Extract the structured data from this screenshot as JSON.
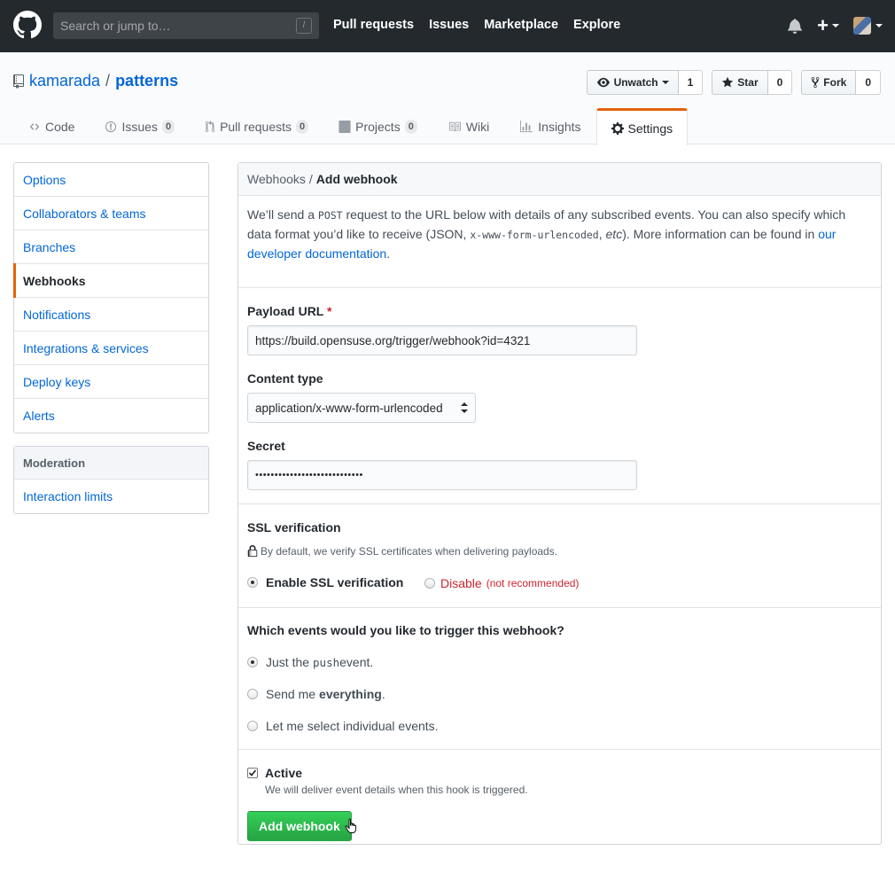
{
  "header": {
    "search_placeholder": "Search or jump to…",
    "search_shortcut": "/",
    "nav": [
      "Pull requests",
      "Issues",
      "Marketplace",
      "Explore"
    ],
    "plus_label": "+"
  },
  "repo": {
    "owner": "kamarada",
    "separator": "/",
    "name": "patterns",
    "watch_label": "Unwatch",
    "watch_count": "1",
    "star_label": "Star",
    "star_count": "0",
    "fork_label": "Fork",
    "fork_count": "0",
    "tabs": {
      "code": "Code",
      "issues": "Issues",
      "issues_count": "0",
      "pulls": "Pull requests",
      "pulls_count": "0",
      "projects": "Projects",
      "projects_count": "0",
      "wiki": "Wiki",
      "insights": "Insights",
      "settings": "Settings"
    }
  },
  "sidebar": {
    "items": [
      "Options",
      "Collaborators & teams",
      "Branches",
      "Webhooks",
      "Notifications",
      "Integrations & services",
      "Deploy keys",
      "Alerts"
    ],
    "selected": "Webhooks",
    "moderation_heading": "Moderation",
    "moderation_items": [
      "Interaction limits"
    ]
  },
  "webhook": {
    "breadcrumb_parent": "Webhooks",
    "breadcrumb_sep": "/",
    "breadcrumb_current": "Add webhook",
    "intro": {
      "t1": "We’ll send a ",
      "post": "POST",
      "t2": " request to the URL below with details of any subscribed events. You can also specify which data format you’d like to receive (JSON, ",
      "urlencoded": "x-www-form-urlencoded",
      "t3": ", ",
      "etc": "etc",
      "t4": "). More information can be found in ",
      "link": "our developer documentation",
      "t5": "."
    },
    "payload_label": "Payload URL",
    "required_mark": "*",
    "payload_value": "https://build.opensuse.org/trigger/webhook?id=4321",
    "content_type_label": "Content type",
    "content_type_value": "application/x-www-form-urlencoded",
    "secret_label": "Secret",
    "secret_value": "••••••••••••••••••••••••••••",
    "ssl_label": "SSL verification",
    "ssl_note": "By default, we verify SSL certificates when delivering payloads.",
    "ssl_enable": "Enable SSL verification",
    "ssl_disable": "Disable",
    "ssl_disable_note": "(not recommended)",
    "events_question": "Which events would you like to trigger this webhook?",
    "event_push_pre": "Just the ",
    "event_push_code": "push",
    "event_push_post": " event.",
    "event_all_pre": "Send me ",
    "event_all_bold": "everything",
    "event_all_post": ".",
    "event_select": "Let me select individual events.",
    "active_label": "Active",
    "active_note": "We will deliver event details when this hook is triggered.",
    "submit_label": "Add webhook"
  },
  "colors": {
    "header_bg": "#24292e",
    "link": "#0366d6",
    "accent": "#e36209",
    "primary": "#28a745",
    "danger": "#cb2431"
  }
}
